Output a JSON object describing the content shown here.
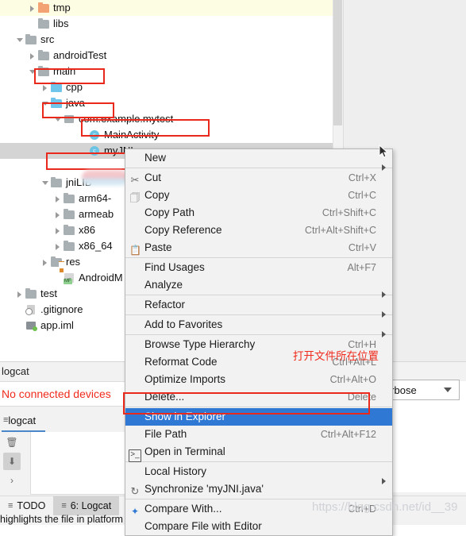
{
  "tree": {
    "rows": [
      {
        "label": "tmp",
        "indent": 36,
        "arrow": "right",
        "icon": "folder-orange",
        "row_style": "highlight-yellow"
      },
      {
        "label": "libs",
        "indent": 36,
        "arrow": "none",
        "icon": "folder-gray",
        "row_style": "none"
      },
      {
        "label": "src",
        "indent": 20,
        "arrow": "down",
        "icon": "folder-gray",
        "row_style": "none"
      },
      {
        "label": "androidTest",
        "indent": 36,
        "arrow": "right",
        "icon": "folder-gray",
        "row_style": "none"
      },
      {
        "label": "main",
        "indent": 36,
        "arrow": "down",
        "icon": "folder-gray",
        "row_style": "none"
      },
      {
        "label": "cpp",
        "indent": 52,
        "arrow": "right",
        "icon": "folder-blue",
        "row_style": "none"
      },
      {
        "label": "java",
        "indent": 52,
        "arrow": "down",
        "icon": "folder-blue",
        "row_style": "none"
      },
      {
        "label": "com.example.mytest",
        "indent": 68,
        "arrow": "down",
        "icon": "package",
        "row_style": "none"
      },
      {
        "label": "MainActivity",
        "indent": 100,
        "arrow": "none",
        "icon": "class",
        "row_style": "none"
      },
      {
        "label": "myJNI",
        "indent": 100,
        "arrow": "none",
        "icon": "class",
        "row_style": "selected-gray"
      },
      {
        "label": "",
        "indent": 100,
        "arrow": "none",
        "icon": "redacted",
        "row_style": "none"
      },
      {
        "label": "jniLIB",
        "indent": 52,
        "arrow": "down",
        "icon": "folder-gray",
        "row_style": "none"
      },
      {
        "label": "arm64-",
        "indent": 68,
        "arrow": "right",
        "icon": "folder-gray",
        "row_style": "none"
      },
      {
        "label": "armeab",
        "indent": 68,
        "arrow": "right",
        "icon": "folder-gray",
        "row_style": "none"
      },
      {
        "label": "x86",
        "indent": 68,
        "arrow": "right",
        "icon": "folder-gray",
        "row_style": "none"
      },
      {
        "label": "x86_64",
        "indent": 68,
        "arrow": "right",
        "icon": "folder-gray",
        "row_style": "none"
      },
      {
        "label": "res",
        "indent": 52,
        "arrow": "right",
        "icon": "folder-res",
        "row_style": "none"
      },
      {
        "label": "AndroidM",
        "indent": 68,
        "arrow": "none",
        "icon": "manifest",
        "row_style": "none"
      },
      {
        "label": "test",
        "indent": 20,
        "arrow": "right",
        "icon": "folder-gray",
        "row_style": "none"
      },
      {
        "label": ".gitignore",
        "indent": 20,
        "arrow": "none",
        "icon": "gitignore",
        "row_style": "none"
      },
      {
        "label": "app.iml",
        "indent": 20,
        "arrow": "none",
        "icon": "iml",
        "row_style": "none"
      }
    ]
  },
  "context_menu": {
    "items": [
      {
        "label": "New",
        "key": "",
        "submenu": true,
        "icon": "",
        "sep_before": false,
        "selected": false
      },
      {
        "label": "Cut",
        "key": "Ctrl+X",
        "submenu": false,
        "icon": "scissors-icon",
        "sep_before": true,
        "selected": false
      },
      {
        "label": "Copy",
        "key": "Ctrl+C",
        "submenu": false,
        "icon": "copy-icon",
        "sep_before": false,
        "selected": false
      },
      {
        "label": "Copy Path",
        "key": "Ctrl+Shift+C",
        "submenu": false,
        "icon": "",
        "sep_before": false,
        "selected": false
      },
      {
        "label": "Copy Reference",
        "key": "Ctrl+Alt+Shift+C",
        "submenu": false,
        "icon": "",
        "sep_before": false,
        "selected": false
      },
      {
        "label": "Paste",
        "key": "Ctrl+V",
        "submenu": false,
        "icon": "paste-icon",
        "sep_before": false,
        "selected": false
      },
      {
        "label": "Find Usages",
        "key": "Alt+F7",
        "submenu": false,
        "icon": "",
        "sep_before": true,
        "selected": false
      },
      {
        "label": "Analyze",
        "key": "",
        "submenu": true,
        "icon": "",
        "sep_before": false,
        "selected": false
      },
      {
        "label": "Refactor",
        "key": "",
        "submenu": true,
        "icon": "",
        "sep_before": true,
        "selected": false
      },
      {
        "label": "Add to Favorites",
        "key": "",
        "submenu": true,
        "icon": "",
        "sep_before": true,
        "selected": false
      },
      {
        "label": "Browse Type Hierarchy",
        "key": "Ctrl+H",
        "submenu": false,
        "icon": "",
        "sep_before": true,
        "selected": false
      },
      {
        "label": "Reformat Code",
        "key": "Ctrl+Alt+L",
        "submenu": false,
        "icon": "",
        "sep_before": false,
        "selected": false
      },
      {
        "label": "Optimize Imports",
        "key": "Ctrl+Alt+O",
        "submenu": false,
        "icon": "",
        "sep_before": false,
        "selected": false
      },
      {
        "label": "Delete...",
        "key": "Delete",
        "submenu": false,
        "icon": "",
        "sep_before": false,
        "selected": false
      },
      {
        "label": "Show in Explorer",
        "key": "",
        "submenu": false,
        "icon": "",
        "sep_before": true,
        "selected": true
      },
      {
        "label": "File Path",
        "key": "Ctrl+Alt+F12",
        "submenu": false,
        "icon": "",
        "sep_before": false,
        "selected": false
      },
      {
        "label": "Open in Terminal",
        "key": "",
        "submenu": false,
        "icon": "terminal-icon",
        "sep_before": false,
        "selected": false
      },
      {
        "label": "Local History",
        "key": "",
        "submenu": true,
        "icon": "",
        "sep_before": true,
        "selected": false
      },
      {
        "label": "Synchronize 'myJNI.java'",
        "key": "",
        "submenu": false,
        "icon": "sync-icon",
        "sep_before": false,
        "selected": false
      },
      {
        "label": "Compare With...",
        "key": "Ctrl+D",
        "submenu": false,
        "icon": "compare-icon",
        "sep_before": true,
        "selected": false
      },
      {
        "label": "Compare File with Editor",
        "key": "",
        "submenu": false,
        "icon": "",
        "sep_before": false,
        "selected": false
      }
    ]
  },
  "annotation": {
    "chinese_note": "打开文件所在位置",
    "highlight_color": "#e8291c"
  },
  "logcat": {
    "title": "logcat",
    "no_devices": "No connected devices",
    "tab_label": "logcat",
    "level_filter": "Verbose"
  },
  "bottom_bar": {
    "tabs": [
      {
        "label": "TODO",
        "active": false
      },
      {
        "label": "6: Logcat",
        "active": true
      }
    ]
  },
  "status_tip": "highlights the file in platform",
  "watermark": "https://blog.csdn.net/id__39"
}
